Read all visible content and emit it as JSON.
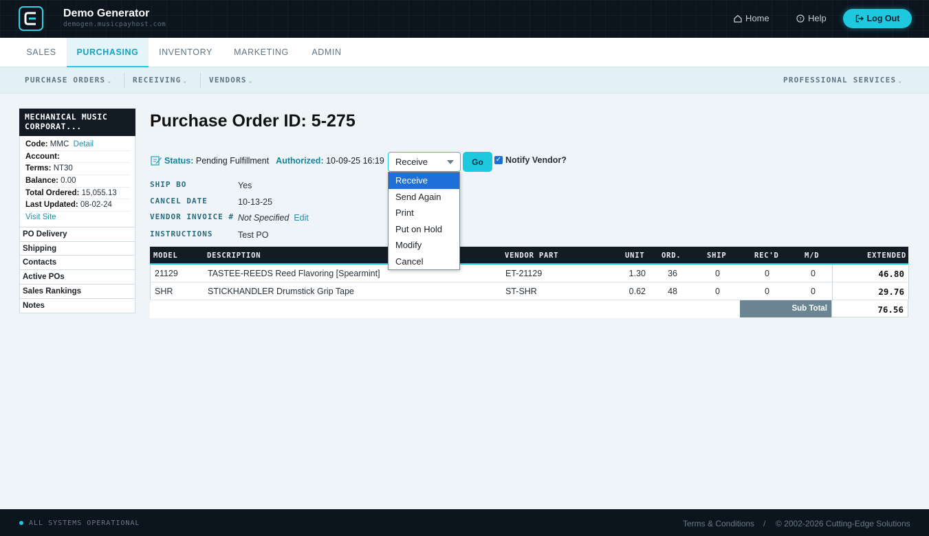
{
  "header": {
    "brand_title": "Demo Generator",
    "brand_sub": "demogen.musicpayhost.com",
    "home": "Home",
    "help": "Help",
    "logout": "Log Out"
  },
  "main_nav": [
    "SALES",
    "PURCHASING",
    "INVENTORY",
    "MARKETING",
    "ADMIN"
  ],
  "main_nav_active": "PURCHASING",
  "sub_nav": {
    "purchase_orders": "PURCHASE ORDERS",
    "receiving": "RECEIVING",
    "vendors": "VENDORS",
    "professional_services": "PROFESSIONAL SERVICES"
  },
  "sidebar": {
    "vendor_name": "MECHANICAL MUSIC CORPORAT...",
    "code_label": "Code:",
    "code_value": "MMC",
    "detail_link": "Detail",
    "account_label": "Account:",
    "terms_label": "Terms:",
    "terms_value": "NT30",
    "balance_label": "Balance:",
    "balance_value": "0.00",
    "total_ordered_label": "Total Ordered:",
    "total_ordered_value": "15,055.13",
    "last_updated_label": "Last Updated:",
    "last_updated_value": "08-02-24",
    "visit_site": "Visit Site",
    "sections": [
      "PO Delivery",
      "Shipping",
      "Contacts",
      "Active POs",
      "Sales Rankings",
      "Notes"
    ]
  },
  "po": {
    "title": "Purchase Order ID: 5-275",
    "status_label": "Status:",
    "status_value": "Pending Fulfillment",
    "authorized_label": "Authorized:",
    "authorized_value": "10-09-25 16:19",
    "action_selected": "Receive",
    "go": "Go",
    "notify_vendor": "Notify Vendor?",
    "notify_checked": true,
    "fields": {
      "ship_bo_label": "SHIP BO",
      "ship_bo_value": "Yes",
      "cancel_date_label": "CANCEL DATE",
      "cancel_date_value": "10-13-25",
      "vendor_invoice_label": "VENDOR INVOICE #",
      "vendor_invoice_value": "Not Specified",
      "vendor_invoice_edit": "Edit",
      "instructions_label": "INSTRUCTIONS",
      "instructions_value": "Test PO"
    }
  },
  "dropdown_options": [
    "Receive",
    "Send Again",
    "Print",
    "Put on Hold",
    "Modify",
    "Cancel"
  ],
  "table": {
    "headers": {
      "model": "MODEL",
      "description": "DESCRIPTION",
      "vendor_part": "VENDOR PART",
      "unit": "UNIT",
      "ord": "ORD.",
      "ship": "SHIP",
      "recd": "REC'D",
      "md": "M/D",
      "extended": "EXTENDED"
    },
    "rows": [
      {
        "model": "21129",
        "description": "TASTEE-REEDS Reed Flavoring [Spearmint]",
        "vendor_part": "ET-21129",
        "unit": "1.30",
        "ord": "36",
        "ship": "0",
        "recd": "0",
        "md": "0",
        "extended": "46.80"
      },
      {
        "model": "SHR",
        "description": "STICKHANDLER Drumstick Grip Tape",
        "vendor_part": "ST-SHR",
        "unit": "0.62",
        "ord": "48",
        "ship": "0",
        "recd": "0",
        "md": "0",
        "extended": "29.76"
      }
    ],
    "subtotal_label": "Sub Total",
    "subtotal_value": "76.56"
  },
  "footer": {
    "status": "ALL SYSTEMS OPERATIONAL",
    "terms": "Terms & Conditions",
    "sep": "/",
    "copyright": "© 2002-2026 Cutting-Edge Solutions"
  },
  "colors": {
    "accent": "#1ec8de",
    "dark": "#0c151e",
    "link": "#1b8fab"
  }
}
